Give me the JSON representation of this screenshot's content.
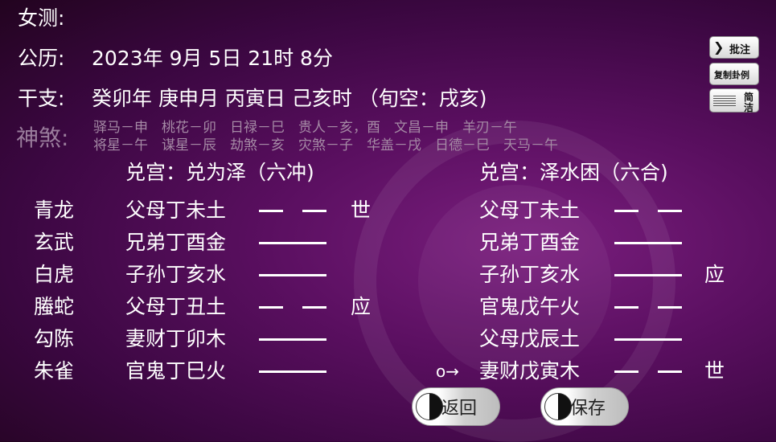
{
  "header": {
    "gender_label": "女测:",
    "calendar_label": "公历:",
    "calendar_value": "2023年 9月 5日 21时 8分",
    "ganzhi_label": "干支:",
    "ganzhi_value": "癸卯年 庚申月 丙寅日 己亥时 （旬空：戌亥)",
    "shensha_label": "神煞:",
    "shensha_row1": "驿马－申　桃花－卯　日禄－巳　贵人－亥，酉　文昌－申　羊刃－午",
    "shensha_row2": "将星－午　谋星－辰　劫煞－亥　灾煞－子　华盖－戌　日德－巳　天马－午"
  },
  "toolbar": {
    "annotate_label": "批注",
    "copy_label": "复制卦例",
    "simple_label_1": "简",
    "simple_label_2": "洁"
  },
  "left_hex": {
    "title": "兑宫：兑为泽（六冲)",
    "gods": [
      "青龙",
      "玄武",
      "白虎",
      "螣蛇",
      "勾陈",
      "朱雀"
    ],
    "lines": [
      {
        "name": "父母丁未土",
        "type": "yin",
        "mark": "世"
      },
      {
        "name": "兄弟丁酉金",
        "type": "yang",
        "mark": ""
      },
      {
        "name": "子孙丁亥水",
        "type": "yang",
        "mark": ""
      },
      {
        "name": "父母丁丑土",
        "type": "yin",
        "mark": "应"
      },
      {
        "name": "妻财丁卯木",
        "type": "yang",
        "mark": ""
      },
      {
        "name": "官鬼丁巳火",
        "type": "yang",
        "mark": ""
      }
    ]
  },
  "right_hex": {
    "title": "兑宫：泽水困（六合)",
    "lines": [
      {
        "name": "父母丁未土",
        "type": "yin",
        "mark": ""
      },
      {
        "name": "兄弟丁酉金",
        "type": "yang",
        "mark": ""
      },
      {
        "name": "子孙丁亥水",
        "type": "yang",
        "mark": "应"
      },
      {
        "name": "官鬼戊午火",
        "type": "yin",
        "mark": ""
      },
      {
        "name": "父母戊辰土",
        "type": "yang",
        "mark": ""
      },
      {
        "name": "妻财戊寅木",
        "type": "yin",
        "mark": "世"
      }
    ],
    "moving_marker": "o→"
  },
  "buttons": {
    "back_label": "返回",
    "save_label": "保存"
  }
}
